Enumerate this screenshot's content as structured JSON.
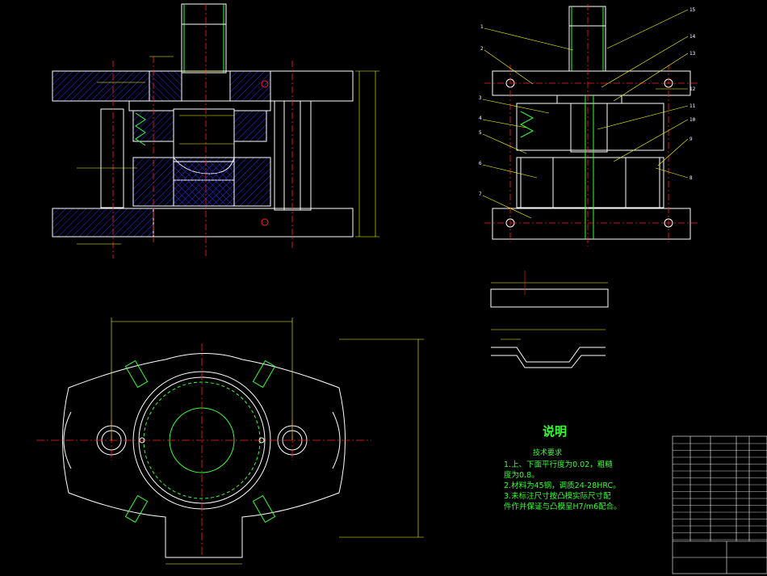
{
  "notes": {
    "heading": "说明",
    "subheading": "技术要求",
    "lines": [
      "1.上、下面平行度为0.02，粗糙",
      "度为0.8。",
      "2.材料为45钢，调质24-28HRC。",
      "3.未标注尺寸按凸模实际尺寸配",
      "件作并保证与凸模呈H7/m6配合。"
    ]
  },
  "callouts": [
    "1",
    "2",
    "3",
    "4",
    "5",
    "6",
    "7",
    "8",
    "9",
    "10",
    "11",
    "12",
    "13",
    "14",
    "15"
  ],
  "colors": {
    "background": "#000000",
    "outline": "#ffffff",
    "centerline": "#ff2020",
    "hatch": "#3030ff",
    "leader": "#ffff00",
    "dimension": "#ffff00",
    "green": "#33ff33",
    "spring": "#33ff33"
  }
}
